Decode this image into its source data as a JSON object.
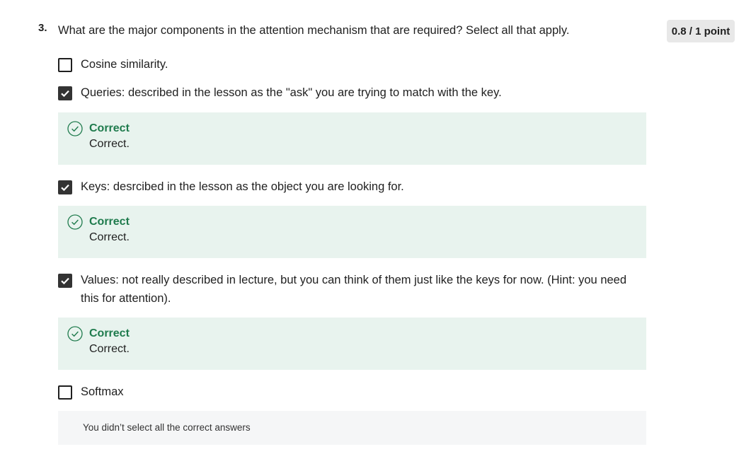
{
  "question": {
    "number": "3.",
    "text": "What are the major components in the attention mechanism that are required? Select all that apply.",
    "score": "0.8 / 1 point"
  },
  "options": [
    {
      "label": "Cosine similarity.",
      "checked": false
    },
    {
      "label": "Queries: described in the lesson as the \"ask\" you are trying to match with the key.",
      "checked": true,
      "feedback": {
        "title": "Correct",
        "body": "Correct."
      }
    },
    {
      "label": "Keys: desrcibed in the lesson as the object you are looking for.",
      "checked": true,
      "feedback": {
        "title": "Correct",
        "body": "Correct."
      }
    },
    {
      "label": "Values: not really described in lecture, but you can think of them just like the keys for now. (Hint: you need this for attention).",
      "checked": true,
      "feedback": {
        "title": "Correct",
        "body": "Correct."
      }
    },
    {
      "label": "Softmax",
      "checked": false
    }
  ],
  "summary": "You didn’t select all the correct answers",
  "icons": {
    "checkbox_checked": "checkmark-icon",
    "feedback_correct": "check-circle-icon"
  },
  "colors": {
    "correct_green": "#1f7b4d",
    "feedback_bg": "#e8f3ee",
    "checked_box": "#333333",
    "summary_bg": "#f5f6f7"
  }
}
